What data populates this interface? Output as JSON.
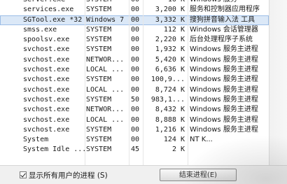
{
  "processes": [
    {
      "name": "services.exe",
      "user": "SYSTEM",
      "cpu": "00",
      "memory": "3,200 K",
      "description": "服务和控制器应用程序",
      "selected": false
    },
    {
      "name": "SGTool.exe *32",
      "user": "Windows 7",
      "cpu": "00",
      "memory": "3,332 K",
      "description": "搜狗拼音输入法 工具",
      "selected": true
    },
    {
      "name": "smss.exe",
      "user": "SYSTEM",
      "cpu": "00",
      "memory": "112 K",
      "description": "Windows 会话管理器",
      "selected": false
    },
    {
      "name": "spoolsv.exe",
      "user": "SYSTEM",
      "cpu": "00",
      "memory": "2,220 K",
      "description": "后台处理程序子系统",
      "selected": false
    },
    {
      "name": "svchost.exe",
      "user": "SYSTEM",
      "cpu": "00",
      "memory": "1,932 K",
      "description": "Windows 服务主进程",
      "selected": false
    },
    {
      "name": "svchost.exe",
      "user": "NETWOR...",
      "cpu": "00",
      "memory": "5,420 K",
      "description": "Windows 服务主进程",
      "selected": false
    },
    {
      "name": "svchost.exe",
      "user": "LOCAL ...",
      "cpu": "00",
      "memory": "6,636 K",
      "description": "Windows 服务主进程",
      "selected": false
    },
    {
      "name": "svchost.exe",
      "user": "SYSTEM",
      "cpu": "00",
      "memory": "100,9...",
      "description": "Windows 服务主进程",
      "selected": false
    },
    {
      "name": "svchost.exe",
      "user": "LOCAL ...",
      "cpu": "00",
      "memory": "8,724 K",
      "description": "Windows 服务主进程",
      "selected": false
    },
    {
      "name": "svchost.exe",
      "user": "SYSTEM",
      "cpu": "50",
      "memory": "983,1...",
      "description": "Windows 服务主进程",
      "selected": false
    },
    {
      "name": "svchost.exe",
      "user": "NETWOR...",
      "cpu": "00",
      "memory": "8,432 K",
      "description": "Windows 服务主进程",
      "selected": false
    },
    {
      "name": "svchost.exe",
      "user": "LOCAL ...",
      "cpu": "00",
      "memory": "8,888 K",
      "description": "Windows 服务主进程",
      "selected": false
    },
    {
      "name": "svchost.exe",
      "user": "SYSTEM",
      "cpu": "00",
      "memory": "1,216 K",
      "description": "Windows 服务主进程",
      "selected": false
    },
    {
      "name": "System",
      "user": "SYSTEM",
      "cpu": "00",
      "memory": "124 K",
      "description": "NT K...",
      "selected": false
    },
    {
      "name": "System Idle ...",
      "user": "SYSTEM",
      "cpu": "45",
      "memory": "2 K",
      "description": "",
      "selected": false
    }
  ],
  "footer": {
    "show_all_label": "显示所有用户的进程 (S)",
    "show_all_checked": true,
    "end_process_label": "结束进程(E)"
  }
}
